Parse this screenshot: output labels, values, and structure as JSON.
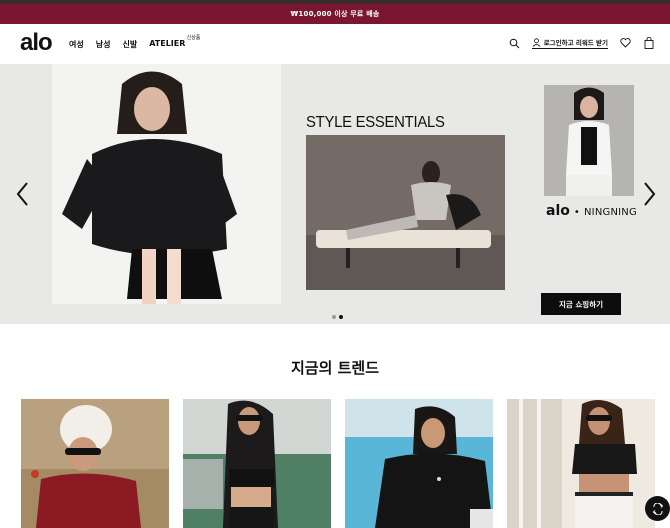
{
  "promo": {
    "text": "₩100,000 이상 무료 배송"
  },
  "nav": {
    "logo": "alo",
    "menu": [
      {
        "label": "여성"
      },
      {
        "label": "남성"
      },
      {
        "label": "신발"
      },
      {
        "label": "ATELIER",
        "badge": "신상품"
      }
    ],
    "login_label": "로그인하고 리워드 받기",
    "icons": [
      "search-icon",
      "user-icon",
      "heart-icon",
      "bag-icon"
    ]
  },
  "hero": {
    "title": "STYLE ESSENTIALS",
    "collab_brand": "alo",
    "collab_separator": "•",
    "collab_name": "NINGNING",
    "cta_label": "지금 쇼핑하기",
    "slide_count": 2,
    "active_slide": 2
  },
  "trend": {
    "title": "지금의 트렌드",
    "cards": [
      {
        "name": "trend-card-1"
      },
      {
        "name": "trend-card-2"
      },
      {
        "name": "trend-card-3"
      },
      {
        "name": "trend-card-4"
      }
    ]
  },
  "colors": {
    "promo_bg": "#7a1630",
    "hero_bg": "#e8e8e6",
    "button_bg": "#0d0d0d"
  }
}
